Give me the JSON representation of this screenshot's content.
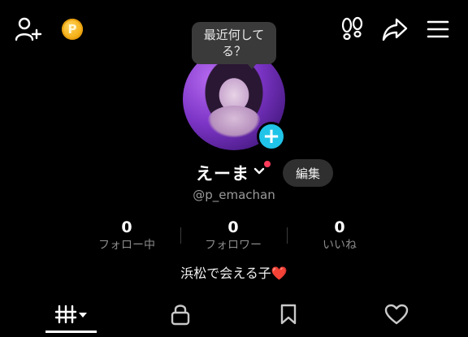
{
  "topbar": {
    "left_icons": [
      "add-friend-icon",
      "coin-icon"
    ],
    "coin_symbol": "P",
    "right_icons": [
      "footprints-icon",
      "share-icon",
      "menu-icon"
    ]
  },
  "tooltip": {
    "line1": "最近何して",
    "line2": "る？"
  },
  "profile": {
    "display_name": "えーま",
    "edit_label": "編集",
    "handle": "@p_emachan",
    "bio_text": "浜松で会える子",
    "bio_emoji": "❤️"
  },
  "stats": [
    {
      "value": "0",
      "label": "フォロー中"
    },
    {
      "value": "0",
      "label": "フォロワー"
    },
    {
      "value": "0",
      "label": "いいね"
    }
  ],
  "tabs": [
    {
      "icon": "videos-grid-icon",
      "selected": true
    },
    {
      "icon": "lock-icon",
      "selected": false
    },
    {
      "icon": "bookmark-icon",
      "selected": false
    },
    {
      "icon": "heart-icon",
      "selected": false
    }
  ],
  "colors": {
    "background": "#000000",
    "accent_badge": "#20c4e8",
    "notification_dot": "#ff3b5c",
    "coin": "#f5b21a"
  }
}
